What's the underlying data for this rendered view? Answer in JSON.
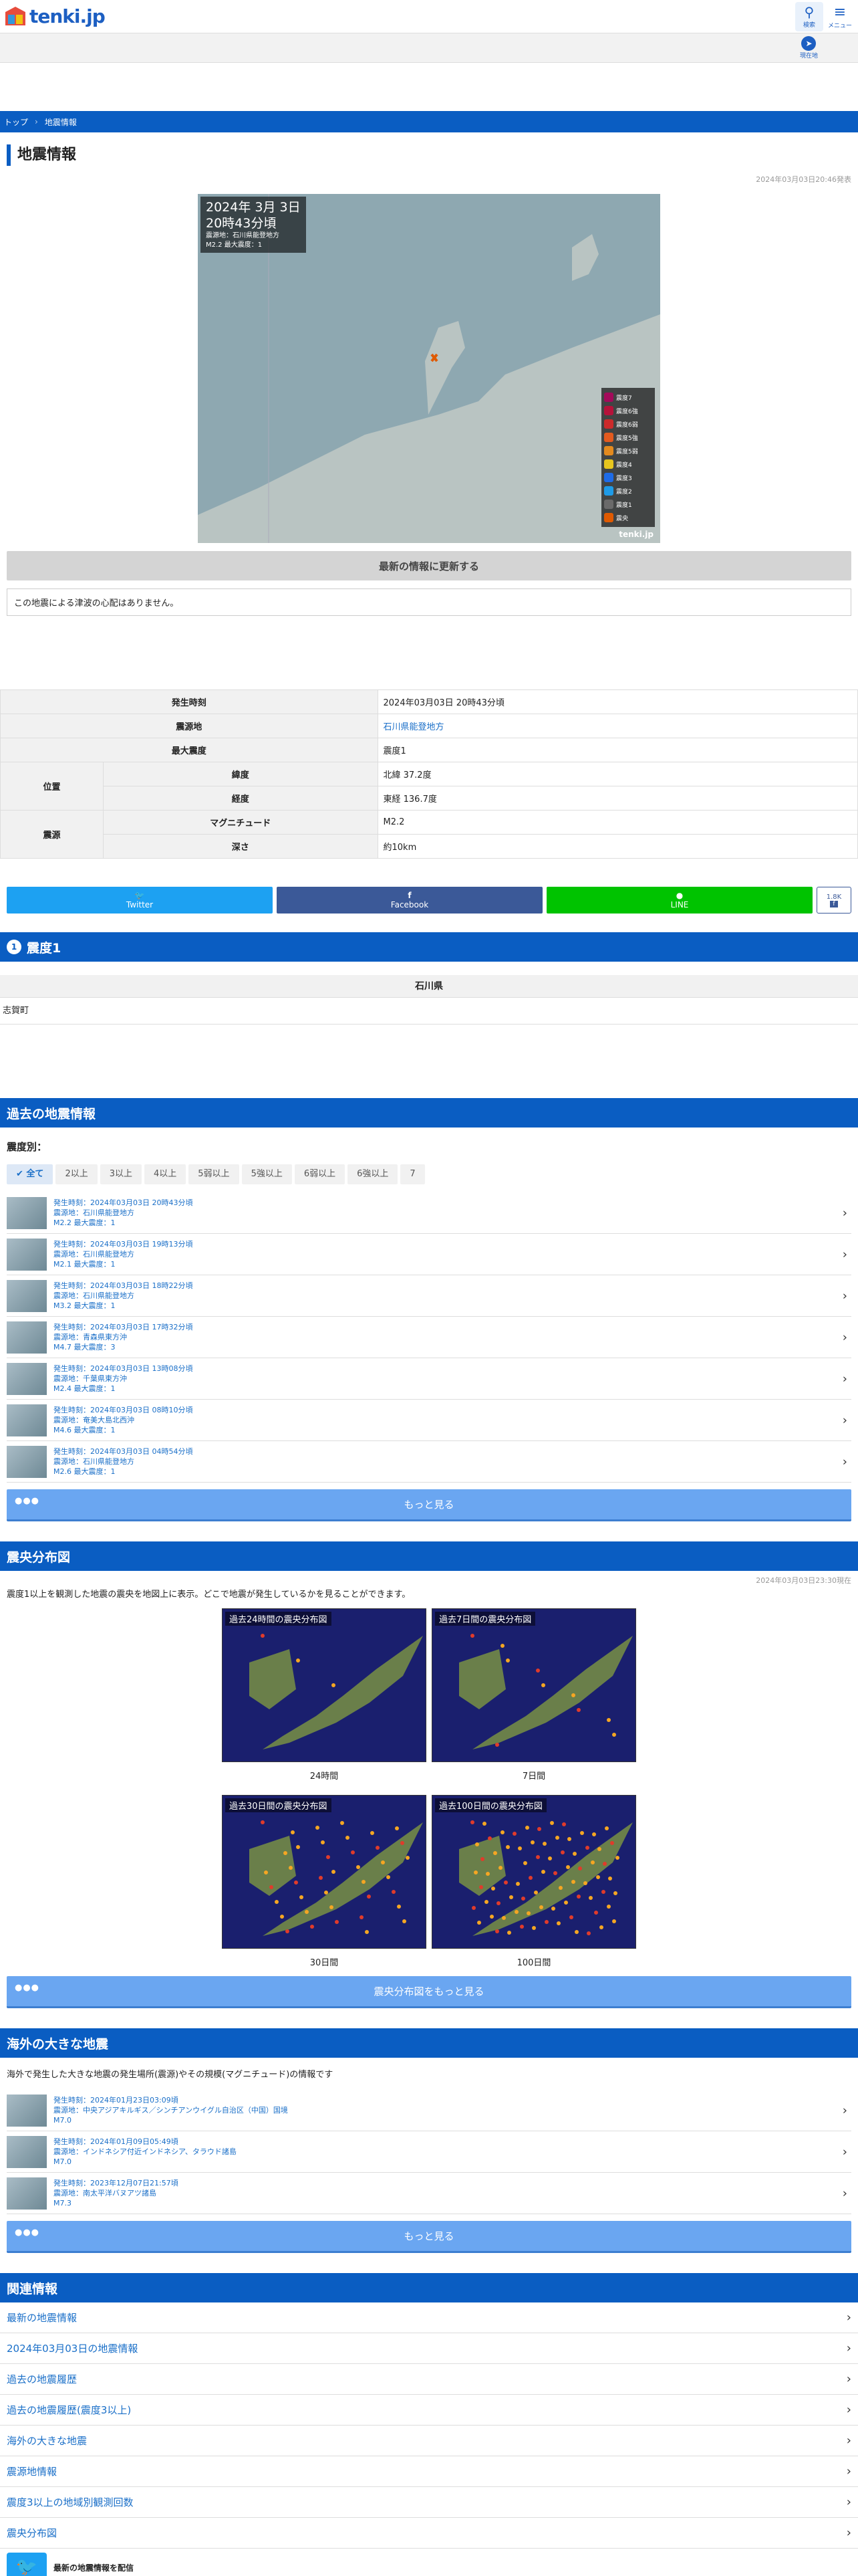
{
  "header": {
    "logo_text": "tenki.jp",
    "search_label": "検索",
    "menu_label": "メニュー",
    "location_label": "現在地"
  },
  "breadcrumb": [
    "トップ",
    "地震情報"
  ],
  "page_title": "地震情報",
  "updated_at": "2024年03月03日20:46発表",
  "map": {
    "date_line": "2024年  3月  3日",
    "time_line": "20時43分頃",
    "epicenter_line": "震源地：石川県能登地方",
    "mag_line": "M2.2  最大震度：1",
    "legend": [
      "震度7",
      "震度6強",
      "震度6弱",
      "震度5強",
      "震度5弱",
      "震度4",
      "震度3",
      "震度2",
      "震度1",
      "震央"
    ],
    "legend_colors": [
      "#a30a5a",
      "#b5123a",
      "#cc2a2a",
      "#e35a1e",
      "#e38a1e",
      "#e7c51e",
      "#1e6be7",
      "#1e9be7",
      "#6a6a6a",
      "#e05a00"
    ],
    "logo": "tenki.jp"
  },
  "update_button": "最新の情報に更新する",
  "tsunami_text": "この地震による津波の心配はありません。",
  "detail": {
    "time_label": "発生時刻",
    "time_value": "2024年03月03日 20時43分頃",
    "epicenter_label": "震源地",
    "epicenter_value": "石川県能登地方",
    "maxint_label": "最大震度",
    "maxint_value": "震度1",
    "position_label": "位置",
    "lat_label": "緯度",
    "lat_value": "北緯 37.2度",
    "lon_label": "経度",
    "lon_value": "東経 136.7度",
    "source_label": "震源",
    "mag_label": "マグニチュード",
    "mag_value": "M2.2",
    "depth_label": "深さ",
    "depth_value": "約10km"
  },
  "share": {
    "twitter": "Twitter",
    "facebook": "Facebook",
    "line": "LINE",
    "fb_count": "1.8K"
  },
  "intensity_section": {
    "title": "震度1",
    "pref": "石川県",
    "city": "志賀町"
  },
  "past": {
    "title": "過去の地震情報",
    "filter_label": "震度別：",
    "filters": [
      "全て",
      "2以上",
      "3以上",
      "4以上",
      "5弱以上",
      "5強以上",
      "6弱以上",
      "6強以上",
      "7"
    ],
    "items": [
      {
        "time": "発生時刻：2024年03月03日 20時43分頃",
        "place": "震源地：石川県能登地方",
        "mag": "M2.2  最大震度：1"
      },
      {
        "time": "発生時刻：2024年03月03日 19時13分頃",
        "place": "震源地：石川県能登地方",
        "mag": "M2.1  最大震度：1"
      },
      {
        "time": "発生時刻：2024年03月03日 18時22分頃",
        "place": "震源地：石川県能登地方",
        "mag": "M3.2  最大震度：1"
      },
      {
        "time": "発生時刻：2024年03月03日 17時32分頃",
        "place": "震源地：青森県東方沖",
        "mag": "M4.7  最大震度：3"
      },
      {
        "time": "発生時刻：2024年03月03日 13時08分頃",
        "place": "震源地：千葉県東方沖",
        "mag": "M2.4  最大震度：1"
      },
      {
        "time": "発生時刻：2024年03月03日 08時10分頃",
        "place": "震源地：奄美大島北西沖",
        "mag": "M4.6  最大震度：1"
      },
      {
        "time": "発生時刻：2024年03月03日 04時54分頃",
        "place": "震源地：石川県能登地方",
        "mag": "M2.6  最大震度：1"
      }
    ],
    "more": "もっと見る"
  },
  "dist": {
    "title": "震央分布図",
    "updated": "2024年03月03日23:30現在",
    "desc": "震度1以上を観測した地震の震央を地図上に表示。どこで地震が発生しているかを見ることができます。",
    "maps": [
      {
        "label": "過去24時間の震央分布図",
        "caption": "24時間"
      },
      {
        "label": "過去7日間の震央分布図",
        "caption": "7日間"
      },
      {
        "label": "過去30日間の震央分布図",
        "caption": "30日間"
      },
      {
        "label": "過去100日間の震央分布図",
        "caption": "100日間"
      }
    ],
    "more": "震央分布図をもっと見る"
  },
  "overseas": {
    "title": "海外の大きな地震",
    "desc": "海外で発生した大きな地震の発生場所(震源)やその規模(マグニチュード)の情報です",
    "items": [
      {
        "time": "発生時刻：2024年01月23日03:09頃",
        "place": "震源地：中央アジアキルギス／シンチアンウイグル自治区（中国）国境",
        "mag": "M7.0"
      },
      {
        "time": "発生時刻：2024年01月09日05:49頃",
        "place": "震源地：インドネシア付近インドネシア、タラウド諸島",
        "mag": "M7.0"
      },
      {
        "time": "発生時刻：2023年12月07日21:57頃",
        "place": "震源地：南太平洋バヌアツ諸島",
        "mag": "M7.3"
      }
    ],
    "more": "もっと見る"
  },
  "related": {
    "title": "関連情報",
    "items": [
      "最新の地震情報",
      "2024年03月03日の地震情報",
      "過去の地震履歴",
      "過去の地震履歴(震度3以上)",
      "海外の大きな地震",
      "震源地情報",
      "震度3以上の地域別観測回数",
      "震央分布図"
    ]
  },
  "footer": {
    "tw_text": "最新の地震情報を配信"
  }
}
